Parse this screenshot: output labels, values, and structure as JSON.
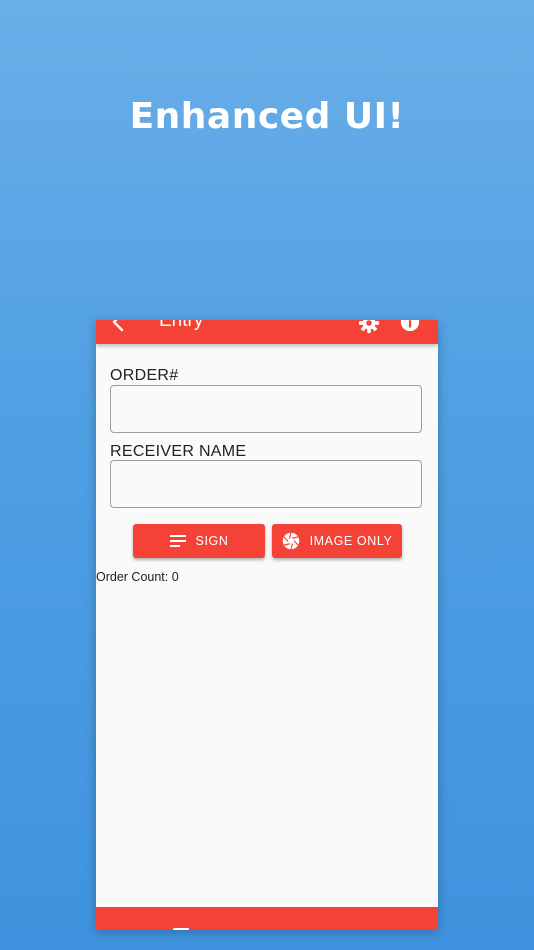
{
  "promo": {
    "headline": "Enhanced UI!"
  },
  "appbar": {
    "title": "Entry",
    "back_icon": "back-arrow-icon",
    "settings_icon": "gear-icon",
    "info_icon": "info-icon"
  },
  "form": {
    "order_label": "ORDER#",
    "order_value": "",
    "receiver_label": "RECEIVER NAME",
    "receiver_value": ""
  },
  "buttons": {
    "sign_label": "SIGN",
    "sign_icon": "lines-icon",
    "image_label": "IMAGE ONLY",
    "image_icon": "camera-shutter-icon"
  },
  "status": {
    "order_count": "Order Count: 0"
  },
  "colors": {
    "accent": "#f44336",
    "background_top": "#6aaee8",
    "background_bottom": "#3f93de",
    "surface": "#fafafa"
  }
}
